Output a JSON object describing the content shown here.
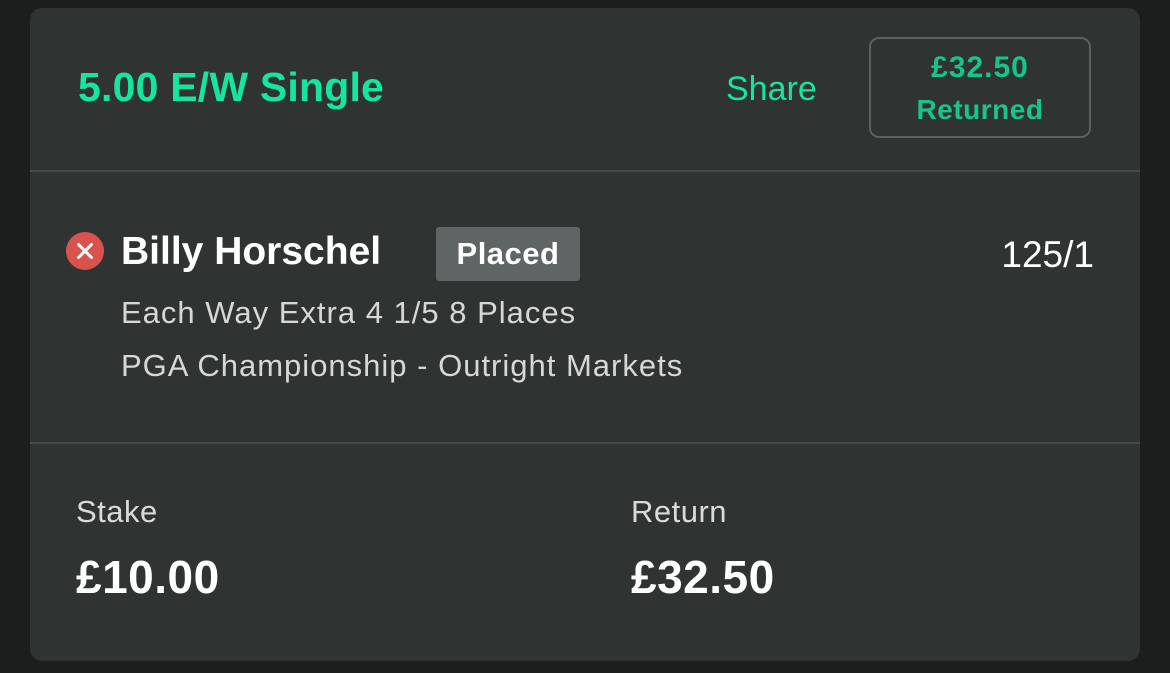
{
  "header": {
    "bet_title": "5.00 E/W Single",
    "share_label": "Share",
    "returned_amount": "£32.50",
    "returned_label": "Returned"
  },
  "selection": {
    "runner_name": "Billy Horschel",
    "status_badge": "Placed",
    "odds": "125/1",
    "market": "Each Way Extra 4 1/5 8 Places",
    "event": "PGA Championship - Outright Markets",
    "status_icon": "close-circle-icon"
  },
  "summary": {
    "stake_label": "Stake",
    "stake_value": "£10.00",
    "return_label": "Return",
    "return_value": "£32.50"
  },
  "colors": {
    "accent": "#14e6a0",
    "card_bg": "#2f3332",
    "page_bg": "#1c1d1d",
    "lost_red": "#d9524e",
    "badge_bg": "#5f6564"
  }
}
